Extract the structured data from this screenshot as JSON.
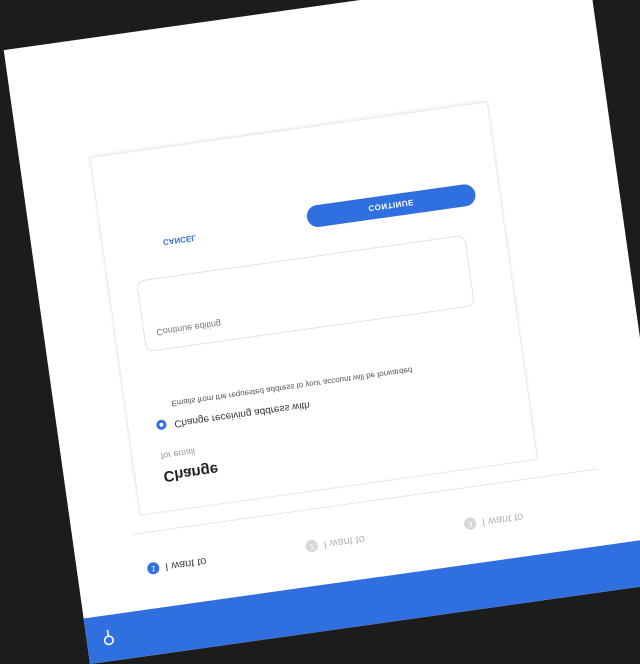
{
  "header": {
    "search_icon": "search-icon",
    "color": "#2f6fe0"
  },
  "stepper": {
    "steps": [
      {
        "number": "1",
        "label": "I want to"
      },
      {
        "number": "2",
        "label": "I want to"
      },
      {
        "number": "3",
        "label": "I want to"
      }
    ]
  },
  "card": {
    "title": "Change",
    "subtitle": "for email",
    "option_label": "Change receiving address with",
    "option_description": "Emails from the requested address to your account will be forwarded",
    "textarea_placeholder": "Continue editing",
    "continue_label": "CONTINUE",
    "cancel_label": "CANCEL"
  }
}
